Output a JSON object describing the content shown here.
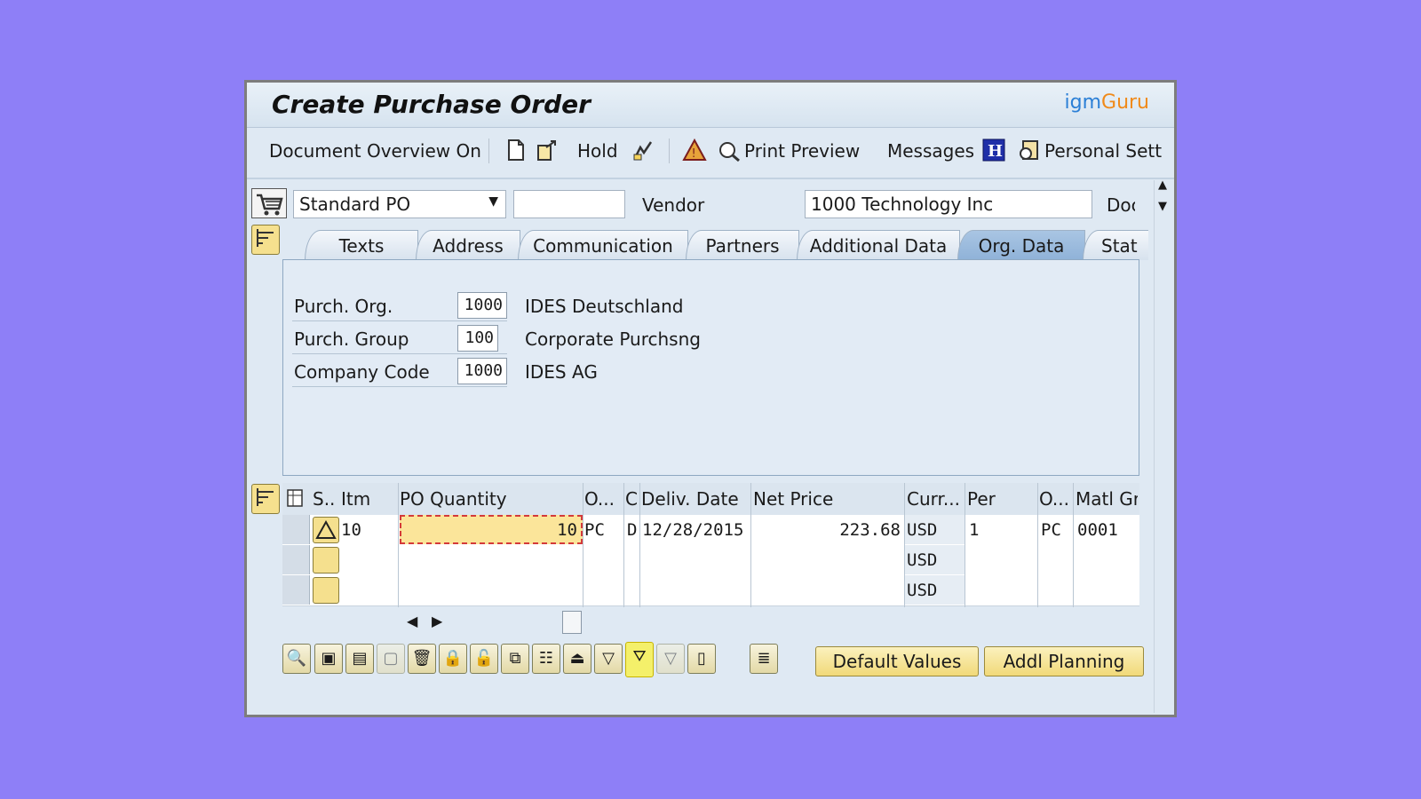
{
  "window": {
    "title": "Create Purchase Order",
    "brand_part1": "igm",
    "brand_part2": "Guru"
  },
  "toolbar": {
    "document_overview": "Document Overview On",
    "hold": "Hold",
    "print_preview": "Print Preview",
    "messages": "Messages",
    "personal_settings": "Personal Sett"
  },
  "header": {
    "doc_type": "Standard PO",
    "po_number": "",
    "vendor_label": "Vendor",
    "vendor_value": "1000 Technology Inc",
    "doc_date_label": "Doc"
  },
  "tabs": [
    "Texts",
    "Address",
    "Communication",
    "Partners",
    "Additional Data",
    "Org. Data",
    "Stat"
  ],
  "active_tab": "Org. Data",
  "org": [
    {
      "label": "Purch. Org.",
      "value": "1000",
      "desc": "IDES Deutschland"
    },
    {
      "label": "Purch. Group",
      "value": "100",
      "desc": "Corporate Purchsng"
    },
    {
      "label": "Company Code",
      "value": "1000",
      "desc": "IDES AG"
    }
  ],
  "grid": {
    "headers": [
      "S..",
      "Itm",
      "PO Quantity",
      "O...",
      "C",
      "Deliv. Date",
      "Net Price",
      "Curr...",
      "Per",
      "O...",
      "Matl Grp"
    ],
    "row1": {
      "itm": "10",
      "qty": "10",
      "oun": "PC",
      "c": "D",
      "date": "12/28/2015",
      "price": "223.68",
      "curr": "USD",
      "per": "1",
      "opu": "PC",
      "matl": "0001"
    },
    "row2": {
      "curr": "USD"
    },
    "row3": {
      "curr": "USD"
    }
  },
  "buttons": {
    "default_values": "Default Values",
    "addl_planning": "Addl Planning"
  },
  "colors": {
    "background": "#8e7ff7",
    "highlight": "#f4f06a",
    "active_tab": "#9ebfe0"
  }
}
